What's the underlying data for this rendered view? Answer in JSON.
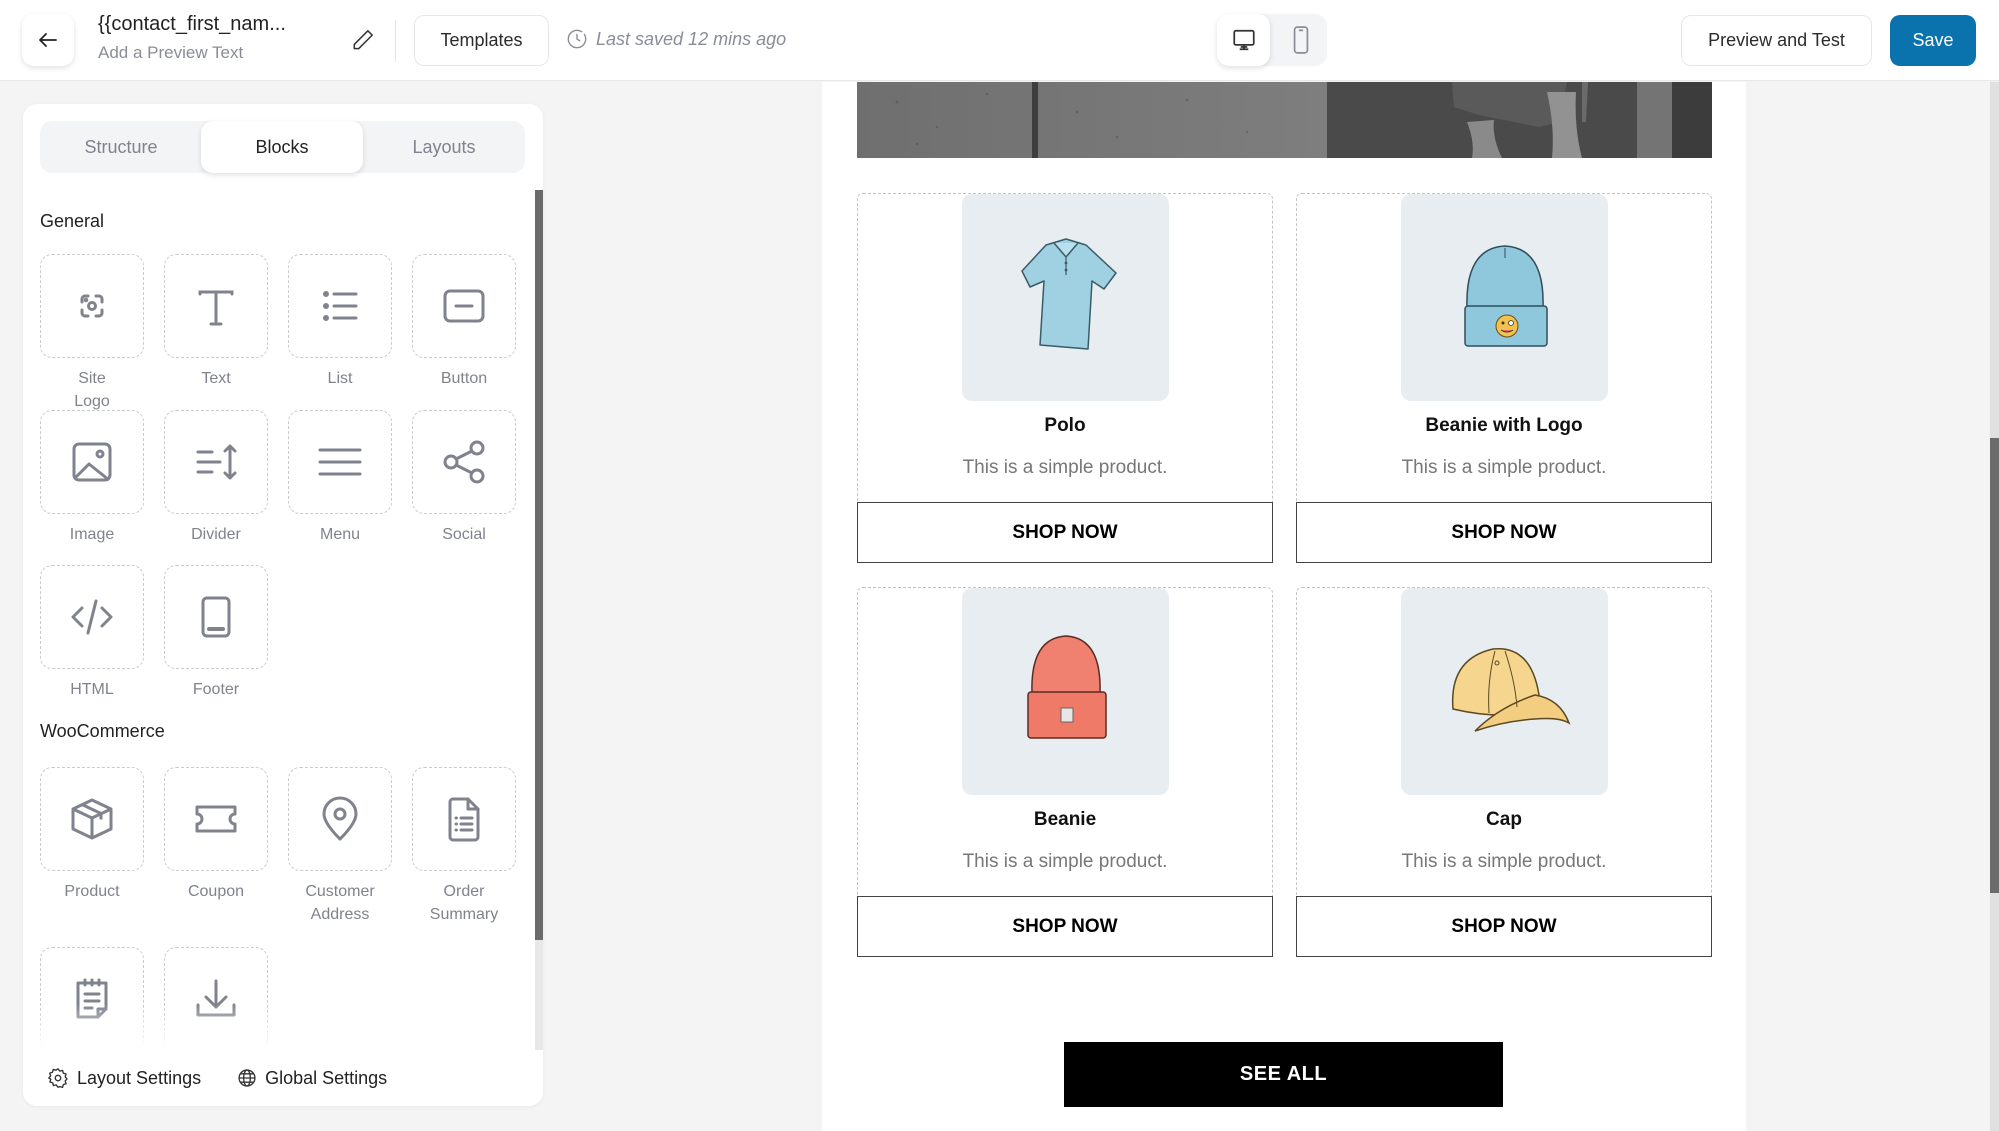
{
  "header": {
    "title": "{{contact_first_nam...",
    "subtitle": "Add a Preview Text",
    "templates_label": "Templates",
    "last_saved": "Last saved 12 mins ago",
    "device_options": [
      {
        "name": "desktop",
        "icon": "desktop-icon",
        "active": true
      },
      {
        "name": "mobile",
        "icon": "mobile-icon",
        "active": false
      }
    ],
    "preview_label": "Preview and Test",
    "save_label": "Save",
    "accent_color": "#0a73ad"
  },
  "panel": {
    "tabs": [
      {
        "label": "Structure",
        "active": false
      },
      {
        "label": "Blocks",
        "active": true
      },
      {
        "label": "Layouts",
        "active": false
      }
    ],
    "sections": [
      {
        "title": "General",
        "blocks": [
          {
            "label": "Site Logo",
            "icon": "site-logo-icon"
          },
          {
            "label": "Text",
            "icon": "text-icon"
          },
          {
            "label": "List",
            "icon": "list-icon"
          },
          {
            "label": "Button",
            "icon": "button-icon"
          },
          {
            "label": "Image",
            "icon": "image-icon"
          },
          {
            "label": "Divider",
            "icon": "divider-icon"
          },
          {
            "label": "Menu",
            "icon": "menu-icon"
          },
          {
            "label": "Social",
            "icon": "share-icon"
          },
          {
            "label": "HTML",
            "icon": "code-icon"
          },
          {
            "label": "Footer",
            "icon": "footer-icon"
          }
        ]
      },
      {
        "title": "WooCommerce",
        "blocks": [
          {
            "label": "Product",
            "icon": "box-icon"
          },
          {
            "label": "Coupon",
            "icon": "ticket-icon"
          },
          {
            "label": "Customer Address",
            "icon": "location-pin-icon"
          },
          {
            "label": "Order Summary",
            "icon": "document-list-icon"
          },
          {
            "label": "",
            "icon": "notepad-icon"
          },
          {
            "label": "",
            "icon": "download-icon"
          }
        ]
      }
    ],
    "footer": {
      "layout_settings": "Layout Settings",
      "global_settings": "Global Settings"
    }
  },
  "email": {
    "products": [
      {
        "name": "Polo",
        "description": "This is a simple product.",
        "button": "SHOP NOW",
        "image": "polo-shirt-image"
      },
      {
        "name": "Beanie with Logo",
        "description": "This is a simple product.",
        "button": "SHOP NOW",
        "image": "beanie-logo-image"
      },
      {
        "name": "Beanie",
        "description": "This is a simple product.",
        "button": "SHOP NOW",
        "image": "beanie-image"
      },
      {
        "name": "Cap",
        "description": "This is a simple product.",
        "button": "SHOP NOW",
        "image": "cap-image"
      }
    ],
    "see_all_label": "SEE ALL"
  }
}
